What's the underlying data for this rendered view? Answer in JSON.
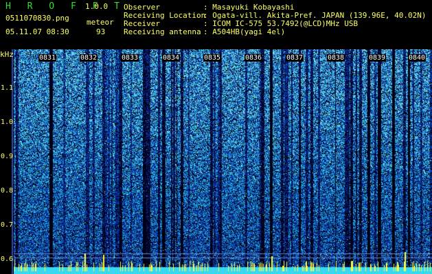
{
  "app": {
    "name": "H R O F F T",
    "version": "1.0.0"
  },
  "file": {
    "name": "0511070830.png",
    "datetime": "05.11.07 08:30",
    "mode_label": "meteor",
    "count": "93"
  },
  "info": [
    {
      "key": "Observer",
      "value": ": Masayuki Kobayashi"
    },
    {
      "key": "Receiving Location",
      "value": ": Ogata-vill. Akita-Pref. JAPAN (139.96E, 40.02N)"
    },
    {
      "key": "Receiver",
      "value": ": ICOM IC-575 53.7492(@LCD)MHz USB"
    },
    {
      "key": "Receiving antenna",
      "value": ": A504HB(yagi 4el)"
    }
  ],
  "axis": {
    "unit": "kHz",
    "y_ticks": [
      "1.1",
      "1.0",
      "0.9",
      "0.8",
      "0.7",
      "0.6"
    ],
    "time_ticks": [
      "0831",
      "0832",
      "0833",
      "0834",
      "0835",
      "0836",
      "0837",
      "0838",
      "0839",
      "0840"
    ]
  },
  "colors": {
    "text": "#ffff66",
    "logo": "#33dd33",
    "background": "#000000",
    "noise_low": "#0a1a8a",
    "noise_mid": "#1e5ad2",
    "noise_high": "#50e6e6",
    "baseline": "#38d8f0",
    "meteor_spikes": "#ffff40"
  }
}
